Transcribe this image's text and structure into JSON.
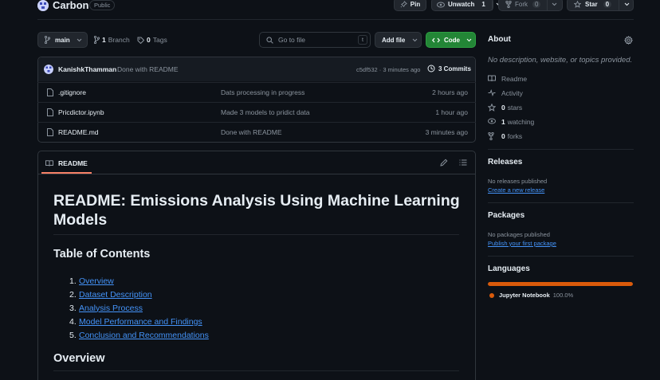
{
  "repo": {
    "name": "Carbon",
    "visibility": "Public"
  },
  "header_actions": {
    "pin": "Pin",
    "unwatch": "Unwatch",
    "unwatch_count": "1",
    "fork": "Fork",
    "fork_count": "0",
    "star": "Star",
    "star_count": "0"
  },
  "toolbar": {
    "branch": "main",
    "branches_count": "1",
    "branches_label": "Branch",
    "tags_count": "0",
    "tags_label": "Tags",
    "search_placeholder": "Go to file",
    "search_shortcut": "t",
    "add_file": "Add file",
    "code": "Code"
  },
  "commit": {
    "author": "KanishkThamman",
    "message": "Done with README",
    "hash_time": "c5df532 · 3 minutes ago",
    "commits": "3 Commits"
  },
  "files": [
    {
      "name": ".gitignore",
      "message": "Dats processing in progress",
      "time": "2 hours ago"
    },
    {
      "name": "Pricdictor.ipynb",
      "message": "Made 3 models to pridict data",
      "time": "1 hour ago"
    },
    {
      "name": "README.md",
      "message": "Done with README",
      "time": "3 minutes ago"
    }
  ],
  "readme": {
    "tab": "README",
    "title_line1": "README: Emissions Analysis Using Machine Learning",
    "title_line2": "Models",
    "toc_heading": "Table of Contents",
    "toc": [
      {
        "n": "1.",
        "label": "Overview"
      },
      {
        "n": "2.",
        "label": "Dataset Description"
      },
      {
        "n": "3.",
        "label": "Analysis Process"
      },
      {
        "n": "4.",
        "label": "Model Performance and Findings"
      },
      {
        "n": "5.",
        "label": "Conclusion and Recommendations"
      }
    ],
    "overview_heading": "Overview"
  },
  "sidebar": {
    "about_title": "About",
    "about_text": "No description, website, or topics provided.",
    "readme": "Readme",
    "activity": "Activity",
    "stars_count": "0",
    "stars_label": "stars",
    "watching_count": "1",
    "watching_label": "watching",
    "forks_count": "0",
    "forks_label": "forks",
    "releases_title": "Releases",
    "releases_text": "No releases published",
    "releases_link": "Create a new release",
    "packages_title": "Packages",
    "packages_text": "No packages published",
    "packages_link": "Publish your first package",
    "languages_title": "Languages",
    "language_name": "Jupyter Notebook",
    "language_percent": "100.0%",
    "language_fraction": 1.0,
    "language_color": "#DA5B0B"
  }
}
